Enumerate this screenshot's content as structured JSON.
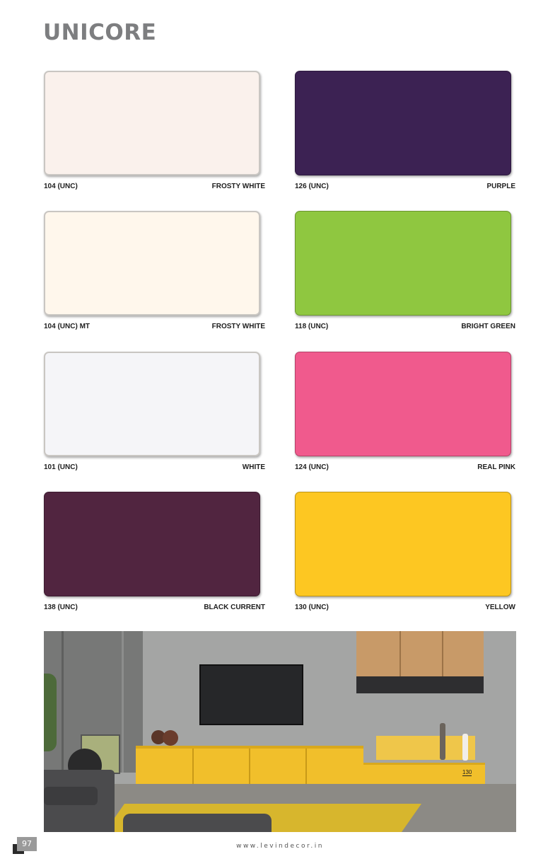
{
  "page": {
    "title": "UNICORE",
    "page_number": "97",
    "website": "www.levindecor.in"
  },
  "swatches": [
    {
      "code": "104 (UNC)",
      "name": "FROSTY WHITE",
      "color": "#faf1ec"
    },
    {
      "code": "126 (UNC)",
      "name": "PURPLE",
      "color": "#3c2253"
    },
    {
      "code": "104 (UNC) MT",
      "name": "FROSTY WHITE",
      "color": "#fff7ec"
    },
    {
      "code": "118 (UNC)",
      "name": "BRIGHT GREEN",
      "color": "#8fc740"
    },
    {
      "code": "101 (UNC)",
      "name": "WHITE",
      "color": "#f5f5f8"
    },
    {
      "code": "124 (UNC)",
      "name": "REAL PINK",
      "color": "#f05a8d"
    },
    {
      "code": "138 (UNC)",
      "name": "BLACK CURRENT",
      "color": "#512540"
    },
    {
      "code": "130 (UNC)",
      "name": "YELLOW",
      "color": "#fdc722"
    }
  ],
  "photo": {
    "cabinet_tag": "130",
    "colors": {
      "wall": "#a7a8a7",
      "cabinet": "#f1bf2b",
      "wood": "#c89a68",
      "floor": "#8a8884",
      "rug": "#d7b62d",
      "sofa": "#4b4b4d"
    }
  }
}
